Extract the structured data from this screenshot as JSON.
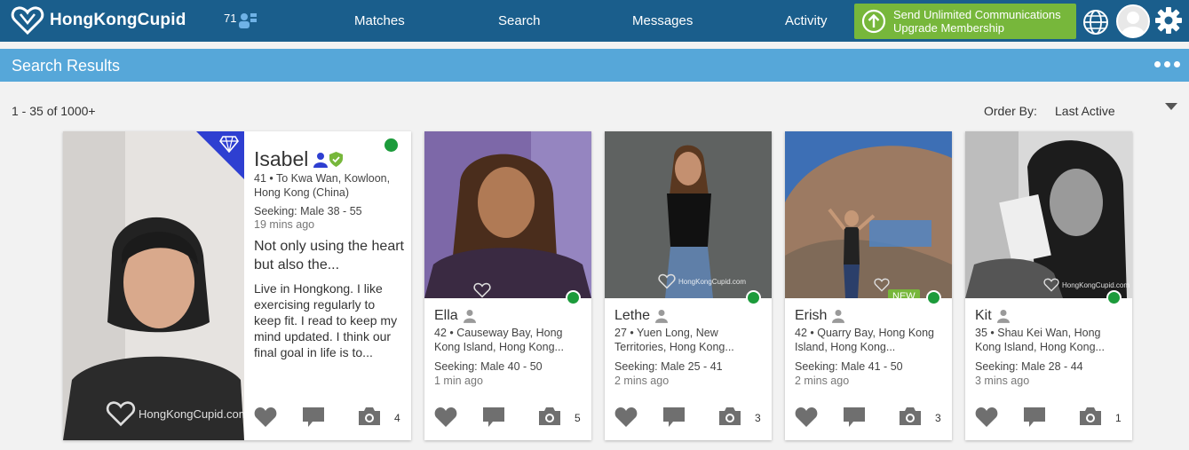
{
  "brand": {
    "name": "HongKongCupid"
  },
  "header": {
    "notification_count": "71",
    "nav": [
      "Matches",
      "Search",
      "Messages",
      "Activity"
    ],
    "upgrade": {
      "line1": "Send Unlimited Communications",
      "line2": "Upgrade Membership"
    }
  },
  "subbar": {
    "title": "Search Results"
  },
  "results": {
    "count_text": "1 - 35 of 1000+",
    "order_by_label": "Order By:",
    "order_by_value": "Last Active"
  },
  "colors": {
    "topbar": "#1a5e8c",
    "subbar": "#56a7d9",
    "upgrade": "#77b73b",
    "online": "#1c9b3b",
    "diamond_badge": "#2e3fd1"
  },
  "profiles": [
    {
      "name": "Isabel",
      "location": "41 • To Kwa Wan, Kowloon, Hong Kong (China)",
      "seeking": "Seeking: Male 38 - 55",
      "last_active": "19 mins ago",
      "headline": "Not only using the heart but also the...",
      "bio": "Live in Hongkong. I like exercising regularly to keep fit. I read to keep my mind updated. I think our final goal in life is to...",
      "photos": "4",
      "icons": [
        "person-icon",
        "verified-shield-icon",
        "diamond-icon"
      ]
    },
    {
      "name": "Ella",
      "location": "42 • Causeway Bay, Hong Kong Island, Hong Kong...",
      "seeking": "Seeking: Male 40 - 50",
      "last_active": "1 min ago",
      "photos": "5"
    },
    {
      "name": "Lethe",
      "location": "27 • Yuen Long, New Territories, Hong Kong...",
      "seeking": "Seeking: Male 25 - 41",
      "last_active": "2 mins ago",
      "photos": "3"
    },
    {
      "name": "Erish",
      "location": "42 • Quarry Bay, Hong Kong Island, Hong Kong...",
      "seeking": "Seeking: Male 41 - 50",
      "last_active": "2 mins ago",
      "photos": "3",
      "badge": "NEW"
    },
    {
      "name": "Kit",
      "location": "35 • Shau Kei Wan, Hong Kong Island, Hong Kong...",
      "seeking": "Seeking: Male 28 - 44",
      "last_active": "3 mins ago",
      "photos": "1"
    }
  ],
  "watermark": "HongKongCupid.com"
}
